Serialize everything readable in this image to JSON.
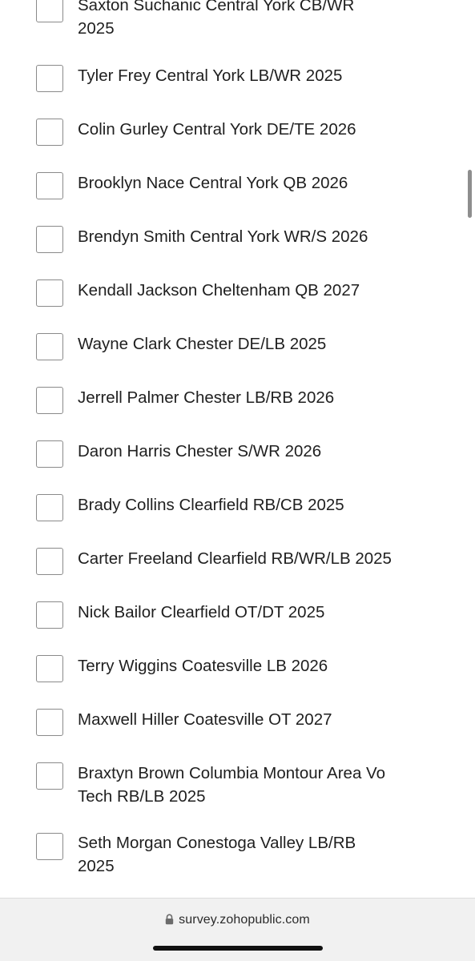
{
  "survey": {
    "items": [
      {
        "label": "Saxton Suchanic Central York CB/WR 2025"
      },
      {
        "label": "Tyler Frey Central York LB/WR 2025"
      },
      {
        "label": "Colin Gurley Central York DE/TE 2026"
      },
      {
        "label": "Brooklyn Nace Central York QB 2026"
      },
      {
        "label": "Brendyn Smith Central York WR/S 2026"
      },
      {
        "label": "Kendall Jackson Cheltenham QB 2027"
      },
      {
        "label": "Wayne Clark Chester DE/LB 2025"
      },
      {
        "label": "Jerrell Palmer Chester LB/RB 2026"
      },
      {
        "label": "Daron Harris Chester S/WR 2026"
      },
      {
        "label": "Brady Collins Clearfield RB/CB 2025"
      },
      {
        "label": "Carter Freeland Clearfield RB/WR/LB 2025"
      },
      {
        "label": "Nick Bailor Clearfield OT/DT 2025"
      },
      {
        "label": "Terry Wiggins Coatesville LB 2026"
      },
      {
        "label": "Maxwell Hiller Coatesville OT 2027"
      },
      {
        "label": "Braxtyn Brown Columbia Montour Area Vo Tech RB/LB 2025"
      },
      {
        "label": "Seth Morgan Conestoga Valley LB/RB 2025"
      }
    ]
  },
  "browser": {
    "url": "survey.zohopublic.com",
    "lock_icon": "lock-icon"
  }
}
